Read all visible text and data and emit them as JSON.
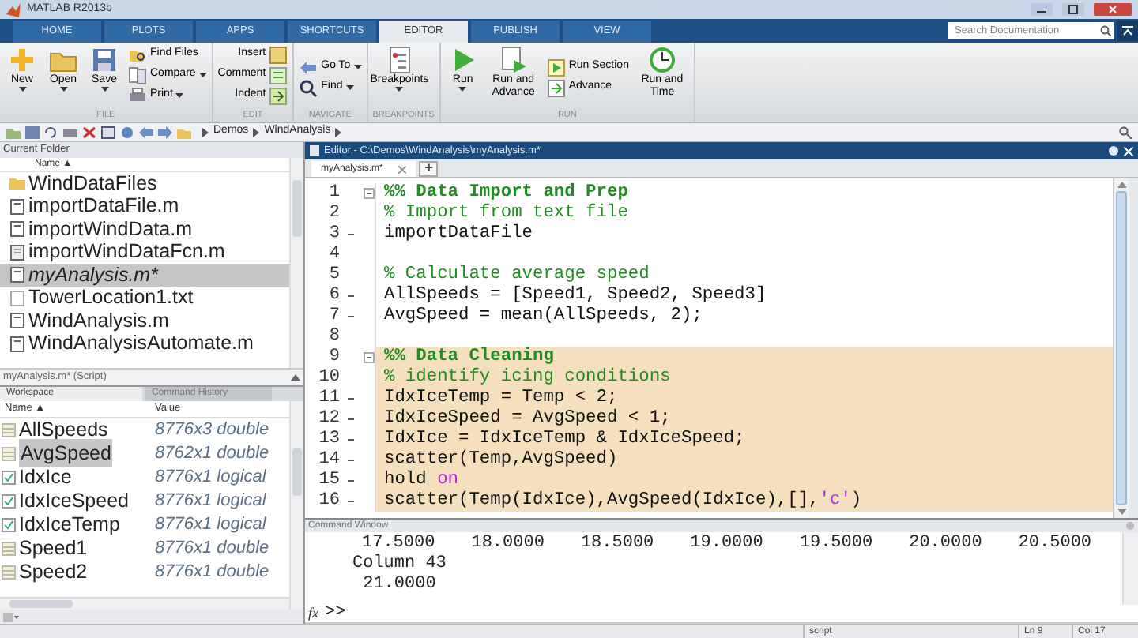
{
  "window": {
    "title": "MATLAB R2013b"
  },
  "ribbon_tabs": [
    {
      "label": "HOME",
      "selected": false
    },
    {
      "label": "PLOTS",
      "selected": false
    },
    {
      "label": "APPS",
      "selected": false
    },
    {
      "label": "SHORTCUTS",
      "selected": false
    },
    {
      "label": "EDITOR",
      "selected": true
    },
    {
      "label": "PUBLISH",
      "selected": false
    },
    {
      "label": "VIEW",
      "selected": false
    }
  ],
  "search": {
    "placeholder": "Search Documentation"
  },
  "ribbon_groups": [
    {
      "label": "FILE",
      "items": [
        {
          "label": "New",
          "kind": "large",
          "dropdown": true
        },
        {
          "label": "Open",
          "kind": "large",
          "dropdown": true
        },
        {
          "label": "Save",
          "kind": "large",
          "dropdown": true
        },
        {
          "label": "Find Files",
          "kind": "small",
          "dropdown": false
        },
        {
          "label": "Compare",
          "kind": "small",
          "dropdown": true
        },
        {
          "label": "Print",
          "kind": "small",
          "dropdown": true
        }
      ]
    },
    {
      "label": "EDIT",
      "items": [
        {
          "label": "Insert",
          "kind": "text-first",
          "dropdown": false
        },
        {
          "label": "Comment",
          "kind": "text-first",
          "dropdown": false
        },
        {
          "label": "Indent",
          "kind": "text-first",
          "dropdown": false
        }
      ]
    },
    {
      "label": "NAVIGATE",
      "items": [
        {
          "label": "Go To",
          "kind": "small",
          "dropdown": true
        },
        {
          "label": "Find",
          "kind": "small",
          "dropdown": true
        }
      ]
    },
    {
      "label": "BREAKPOINTS",
      "items": [
        {
          "label": "Breakpoints",
          "kind": "large",
          "dropdown": true
        }
      ]
    },
    {
      "label": "RUN",
      "items": [
        {
          "label": "Run",
          "kind": "large",
          "dropdown": true
        },
        {
          "label": "Run and Advance",
          "kind": "large",
          "dropdown": false
        },
        {
          "label": "Run Section",
          "kind": "small",
          "dropdown": false
        },
        {
          "label": "Advance",
          "kind": "small",
          "dropdown": false
        },
        {
          "label": "Run and Time",
          "kind": "large",
          "dropdown": false
        }
      ]
    }
  ],
  "address_bar": {
    "path": [
      "Demos",
      "WindAnalysis"
    ]
  },
  "current_folder": {
    "title": "Current Folder",
    "column": "Name ▲",
    "files": [
      {
        "name": "WindDataFiles",
        "kind": "folder",
        "selected": false
      },
      {
        "name": "importDataFile.m",
        "kind": "script",
        "selected": false
      },
      {
        "name": "importWindData.m",
        "kind": "script",
        "selected": false
      },
      {
        "name": "importWindDataFcn.m",
        "kind": "function",
        "selected": false
      },
      {
        "name": "myAnalysis.m*",
        "kind": "script",
        "selected": true
      },
      {
        "name": "TowerLocation1.txt",
        "kind": "text",
        "selected": false
      },
      {
        "name": "WindAnalysis.m",
        "kind": "script",
        "selected": false
      },
      {
        "name": "WindAnalysisAutomate.m",
        "kind": "script",
        "selected": false
      }
    ],
    "details": "myAnalysis.m* (Script)"
  },
  "workspace": {
    "tabs": [
      {
        "label": "Workspace",
        "selected": true
      },
      {
        "label": "Command History",
        "selected": false
      }
    ],
    "columns": [
      "Name ▲",
      "Value"
    ],
    "variables": [
      {
        "name": "AllSpeeds",
        "value": "8776x3 double",
        "kind": "double",
        "selected": false
      },
      {
        "name": "AvgSpeed",
        "value": "8762x1 double",
        "kind": "double",
        "selected": true
      },
      {
        "name": "IdxIce",
        "value": "8776x1 logical",
        "kind": "logical",
        "selected": false
      },
      {
        "name": "IdxIceSpeed",
        "value": "8776x1 logical",
        "kind": "logical",
        "selected": false
      },
      {
        "name": "IdxIceTemp",
        "value": "8776x1 logical",
        "kind": "logical",
        "selected": false
      },
      {
        "name": "Speed1",
        "value": "8776x1 double",
        "kind": "double",
        "selected": false
      },
      {
        "name": "Speed2",
        "value": "8776x1 double",
        "kind": "double",
        "selected": false
      }
    ]
  },
  "editor": {
    "title": "Editor - C:\\Demos\\WindAnalysis\\myAnalysis.m*",
    "tabs": [
      {
        "label": "myAnalysis.m*",
        "selected": true
      }
    ],
    "new_tab": "+",
    "lines": [
      {
        "number": "1",
        "executable": false,
        "fold": true,
        "highlighted": false,
        "segments": [
          {
            "kind": "section",
            "text": "%% Data Import and Prep"
          }
        ]
      },
      {
        "number": "2",
        "executable": false,
        "fold": false,
        "highlighted": false,
        "segments": [
          {
            "kind": "comment",
            "text": "% Import from text file"
          }
        ]
      },
      {
        "number": "3",
        "executable": true,
        "fold": false,
        "highlighted": false,
        "segments": [
          {
            "kind": "code",
            "text": "importDataFile"
          }
        ]
      },
      {
        "number": "4",
        "executable": false,
        "fold": false
      },
      {
        "number": "5",
        "executable": false,
        "fold": false,
        "highlighted": false,
        "segments": [
          {
            "kind": "comment",
            "text": "% Calculate average speed"
          }
        ]
      },
      {
        "number": "6",
        "executable": true,
        "fold": false,
        "highlighted": false,
        "segments": [
          {
            "kind": "code",
            "text": "AllSpeeds = [Speed1, Speed2, Speed3]"
          }
        ]
      },
      {
        "number": "7",
        "executable": true,
        "fold": false,
        "highlighted": false,
        "segments": [
          {
            "kind": "code",
            "text": "AvgSpeed = mean(AllSpeeds, 2);"
          }
        ]
      },
      {
        "number": "8",
        "executable": false,
        "fold": false
      },
      {
        "number": "9",
        "executable": false,
        "fold": true,
        "highlighted": true,
        "segments": [
          {
            "kind": "section",
            "text": "%% Data Cleaning"
          }
        ]
      },
      {
        "number": "10",
        "executable": false,
        "fold": false,
        "highlighted": true,
        "segments": [
          {
            "kind": "comment",
            "text": "% identify icing conditions"
          }
        ]
      },
      {
        "number": "11",
        "executable": true,
        "fold": false,
        "highlighted": true,
        "segments": [
          {
            "kind": "code",
            "text": "IdxIceTemp = Temp < 2;"
          }
        ]
      },
      {
        "number": "12",
        "executable": true,
        "fold": false,
        "highlighted": true,
        "segments": [
          {
            "kind": "code",
            "text": "IdxIceSpeed = AvgSpeed < 1;"
          }
        ]
      },
      {
        "number": "13",
        "executable": true,
        "fold": false,
        "highlighted": true,
        "segments": [
          {
            "kind": "code",
            "text": "IdxIce = IdxIceTemp & IdxIceSpeed;"
          }
        ]
      },
      {
        "number": "14",
        "executable": true,
        "fold": false,
        "highlighted": true,
        "segments": [
          {
            "kind": "code",
            "text": "scatter(Temp,AvgSpeed)"
          }
        ]
      },
      {
        "number": "15",
        "executable": true,
        "fold": false,
        "highlighted": true,
        "segments": [
          {
            "kind": "code",
            "text": "hold "
          },
          {
            "kind": "keyword",
            "text": "on"
          }
        ]
      },
      {
        "number": "16",
        "executable": true,
        "fold": false,
        "highlighted": true,
        "segments": [
          {
            "kind": "code",
            "text": "scatter(Temp(IdxIce),AvgSpeed(IdxIce),[],"
          },
          {
            "kind": "string",
            "text": "'c'"
          },
          {
            "kind": "code",
            "text": ")"
          }
        ]
      }
    ]
  },
  "command_window": {
    "title": "Command Window",
    "output": [
      {
        "kind": "numbers",
        "values": [
          "17.5000",
          "18.0000",
          "18.5000",
          "19.0000",
          "19.5000",
          "20.0000",
          "20.5000"
        ]
      },
      {
        "kind": "text",
        "text": "Column 43"
      },
      {
        "kind": "text",
        "text": " 21.0000"
      }
    ],
    "function_button": "fx",
    "prompt": ">>"
  },
  "status_bar": {
    "mode": "script",
    "line": "Ln 9",
    "column": "Col 17"
  }
}
